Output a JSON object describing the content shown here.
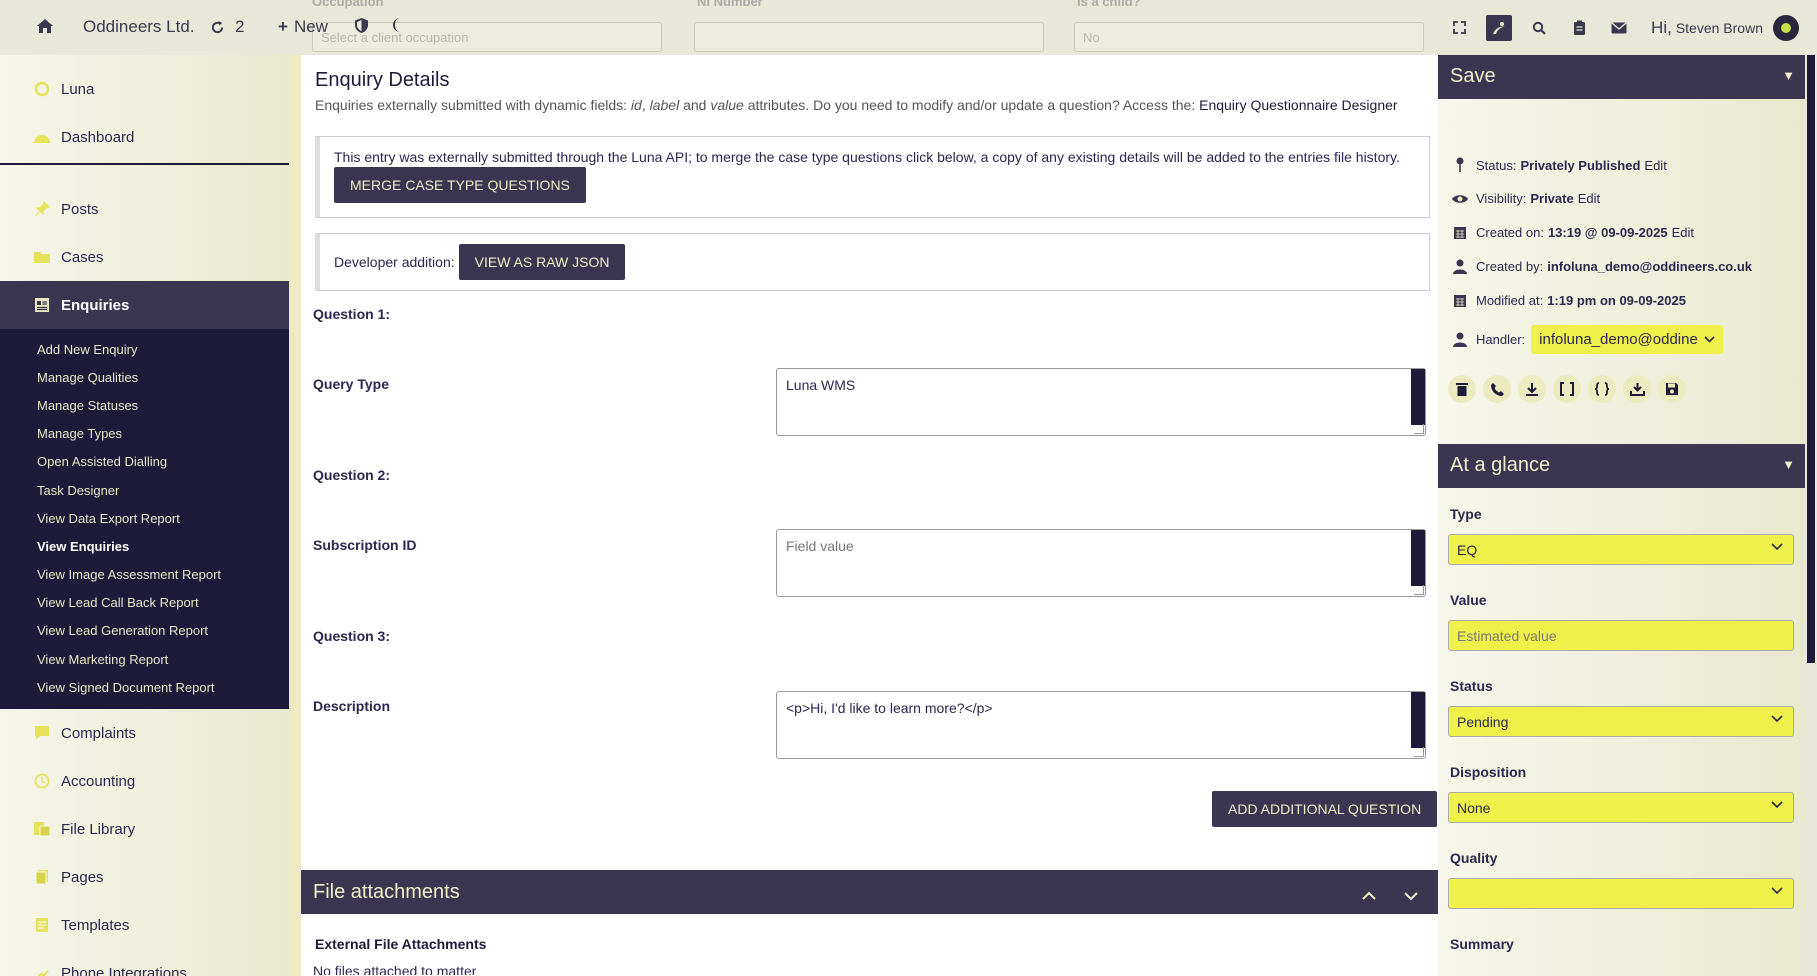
{
  "topbar": {
    "company": "Oddineers Ltd.",
    "sync_count": "2",
    "new_label": "New",
    "greeting": "Hi,",
    "user_name": "Steven Brown",
    "ghost": {
      "label1": "Occupation",
      "value1": "Select a client occupation",
      "label2": "NI Number",
      "label3": "Is a child?",
      "value3": "No"
    }
  },
  "sidebar": {
    "top_items": [
      {
        "label": "Luna",
        "icon": "luna-circle-icon"
      },
      {
        "label": "Dashboard",
        "icon": "dashboard-icon"
      }
    ],
    "items_a": [
      {
        "label": "Posts",
        "icon": "pin-icon"
      },
      {
        "label": "Cases",
        "icon": "folder-icon"
      }
    ],
    "active": {
      "label": "Enquiries",
      "icon": "enquiries-icon"
    },
    "sub_items": [
      "Add New Enquiry",
      "Manage Qualities",
      "Manage Statuses",
      "Manage Types",
      "Open Assisted Dialling",
      "Task Designer",
      "View Data Export Report",
      "View Enquiries",
      "View Image Assessment Report",
      "View Lead Call Back Report",
      "View Lead Generation Report",
      "View Marketing Report",
      "View Signed Document Report"
    ],
    "items_b": [
      {
        "label": "Complaints",
        "icon": "complaint-icon"
      },
      {
        "label": "Accounting",
        "icon": "clock-icon"
      },
      {
        "label": "File Library",
        "icon": "file-library-icon"
      },
      {
        "label": "Pages",
        "icon": "pages-icon"
      },
      {
        "label": "Templates",
        "icon": "templates-icon"
      },
      {
        "label": "Phone Integrations",
        "icon": "phone-icon"
      }
    ]
  },
  "main": {
    "title": "Enquiry Details",
    "subtitle_pre": "Enquiries externally submitted with dynamic fields:",
    "subtitle_id": "id",
    "subtitle_comma": ",",
    "subtitle_label": "label",
    "subtitle_and": "and",
    "subtitle_value": "value",
    "subtitle_post": "attributes. Do you need to modify and/or update a question? Access the:",
    "subtitle_link": "Enquiry Questionnaire Designer",
    "notice_text": "This entry was externally submitted through the Luna API; to merge the case type questions click below, a copy of any existing details will be added to the entries file history.",
    "merge_button": "Merge case type questions",
    "dev_label": "Developer addition:",
    "raw_json_button": "View as raw JSON",
    "questions": [
      {
        "heading": "Question 1:",
        "label": "Query Type",
        "value": "Luna WMS"
      },
      {
        "heading": "Question 2:",
        "label": "Subscription ID",
        "placeholder": "Field value"
      },
      {
        "heading": "Question 3:",
        "label": "Description",
        "value": "<p>Hi, I'd like to learn more?</p>"
      }
    ],
    "add_question_button": "Add additional question",
    "attachments_title": "File attachments",
    "external_heading": "External File Attachments",
    "no_files": "No files attached to matter"
  },
  "rpanel": {
    "save_title": "Save",
    "status_label": "Status:",
    "status_value": "Privately Published",
    "visibility_label": "Visibility:",
    "visibility_value": "Private",
    "created_label": "Created on:",
    "created_value": "13:19 @ 09-09-2025",
    "created_by_label": "Created by:",
    "created_by_value": "infoluna_demo@oddineers.co.uk",
    "modified_label": "Modified at:",
    "modified_value": "1:19 pm on 09-09-2025",
    "handler_label": "Handler:",
    "handler_value": "infoluna_demo@oddine",
    "edit_label": "Edit",
    "glance_title": "At a glance",
    "type_label": "Type",
    "type_value": "EQ",
    "value_label": "Value",
    "value_placeholder": "Estimated value",
    "status_field_label": "Status",
    "status_field_value": "Pending",
    "disposition_label": "Disposition",
    "disposition_value": "None",
    "quality_label": "Quality",
    "quality_value": "",
    "summary_label": "Summary"
  },
  "colors": {
    "dark": "#3a3550",
    "navy": "#1e1b3a",
    "accent_yellow": "#f0f04a",
    "cream": "#f0efc8"
  }
}
